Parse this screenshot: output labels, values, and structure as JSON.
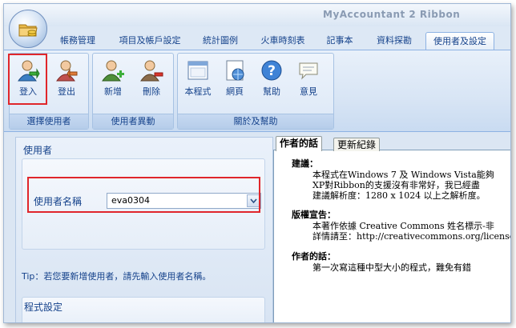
{
  "window": {
    "title": "MyAccountant 2 Ribbon"
  },
  "tabs": [
    {
      "label": "帳務管理"
    },
    {
      "label": "項目及帳戶設定"
    },
    {
      "label": "統計圖例"
    },
    {
      "label": "火車時刻表"
    },
    {
      "label": "記事本"
    },
    {
      "label": "資料探勘"
    },
    {
      "label": "使用者及設定",
      "active": true
    }
  ],
  "ribbon": {
    "groups": [
      {
        "label": "選擇使用者",
        "buttons": [
          {
            "label": "登入",
            "icon": "login-user-icon"
          },
          {
            "label": "登出",
            "icon": "logout-user-icon"
          }
        ]
      },
      {
        "label": "使用者異動",
        "buttons": [
          {
            "label": "新增",
            "icon": "add-user-icon"
          },
          {
            "label": "刪除",
            "icon": "delete-user-icon"
          }
        ]
      },
      {
        "label": "關於及幫助",
        "buttons": [
          {
            "label": "本程式",
            "icon": "window-icon"
          },
          {
            "label": "網頁",
            "icon": "web-page-icon"
          },
          {
            "label": "幫助",
            "icon": "help-icon"
          },
          {
            "label": "意見",
            "icon": "feedback-icon"
          }
        ]
      }
    ]
  },
  "user_panel": {
    "title": "使用者",
    "username_label": "使用者名稱",
    "username_value": "eva0304",
    "tip": "Tip：若您要新增使用者，請先輸入使用者名稱。",
    "program_settings_title": "程式設定"
  },
  "info_panel": {
    "tabs": [
      {
        "label": "作者的話",
        "active": true
      },
      {
        "label": "更新紀錄"
      }
    ],
    "lines": [
      "建議：",
      "本程式在Windows 7 及 Windows Vista能夠",
      "XP對Ribbon的支援沒有非常好，我已經盡",
      "建議解析度：1280 x 1024 以上之解析度。",
      "版權宣告：",
      "本著作依據 Creative Commons 姓名標示-非",
      "詳情請至：http://creativecommons.org/license",
      "作者的話：",
      "第一次寫這種中型大小的程式，難免有錯"
    ]
  },
  "colors": {
    "accent": "#15428b",
    "highlight": "#e0262b",
    "ribbon": "#d8e5f5"
  }
}
